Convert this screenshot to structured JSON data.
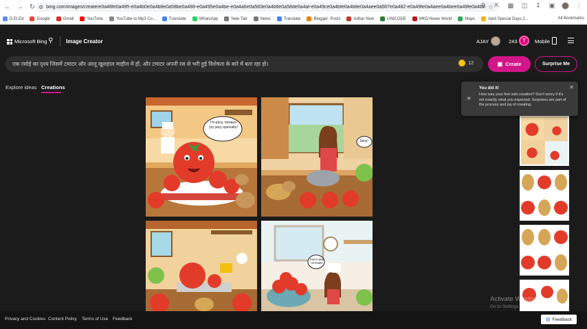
{
  "browser": {
    "url": "bing.com/images/create/e0a48fe0a495-e0a4b0e0a4b8e0a58be0a488-e0a495e0a4be-e0a4a6e0a583e0a4b6e0a58de0a4af-e0a49ce0a4bfe0a4b8e0a4aee0a587e0a482-e0a49fe0a4aee0a4bee0a49fe0a4b0-e0a494e0a4b0-e0a486e0a4b...",
    "bookmarks": [
      {
        "label": "D.El.Ed",
        "color": "#5b8def"
      },
      {
        "label": "Google",
        "color": "#ea4335"
      },
      {
        "label": "Gmail",
        "color": "#d93025"
      },
      {
        "label": "YouTube",
        "color": "#ff0000"
      },
      {
        "label": "YouTube to Mp3 Co...",
        "color": "#888888"
      },
      {
        "label": "Translate",
        "color": "#4285f4"
      },
      {
        "label": "WhatsApp",
        "color": "#25d366"
      },
      {
        "label": "New Tab",
        "color": "#777777"
      },
      {
        "label": "News",
        "color": "#777777"
      },
      {
        "label": "Translate",
        "color": "#4285f4"
      },
      {
        "label": "Blogger: Posts",
        "color": "#f57d00"
      },
      {
        "label": "Adhar New",
        "color": "#c0392b"
      },
      {
        "label": "UNICODE",
        "color": "#2e7d32"
      },
      {
        "label": "MKD-News World",
        "color": "#b71c1c"
      },
      {
        "label": "Maps",
        "color": "#34a853"
      },
      {
        "label": "April Special Days 2...",
        "color": "#f4b400"
      }
    ],
    "all_bookmarks": "All Bookmarks"
  },
  "header": {
    "brand": "Microsoft Bing",
    "title": "Image Creator",
    "user": "AJAY",
    "points": "243",
    "reward_letter": "T",
    "mobile": "Mobile"
  },
  "prompt": {
    "text": "एक रसोई का दृश्य जिसमें टमाटर और आलू खुशहाल माहौल में हों, और टमाटर अपनी रस से भरी हुई विशेषता के बारे में बता रहा हो।",
    "boosts": "12",
    "create_label": "Create",
    "surprise_label": "Surprise Me"
  },
  "tabs": [
    {
      "label": "Explore ideas"
    },
    {
      "label": "Creations"
    }
  ],
  "images": {
    "bubble1": "I'm juicy, tomaus yry juicy specialty!",
    "bubble2": "Juicy!",
    "bubble4": "Tom's taste mt foods!"
  },
  "popup": {
    "title": "You did it!",
    "body": "How was your first solo creation? Don't worry if it's not exactly what you expected. Surprises are part of the process and joy of creating."
  },
  "watermark": {
    "title": "Activate Windows",
    "sub": "Go to Settings to activate Windows."
  },
  "footer": {
    "links": [
      "Privacy and Cookies",
      "Content Policy",
      "Terms of Use",
      "Feedback"
    ],
    "feedback_button": "Feedback"
  }
}
